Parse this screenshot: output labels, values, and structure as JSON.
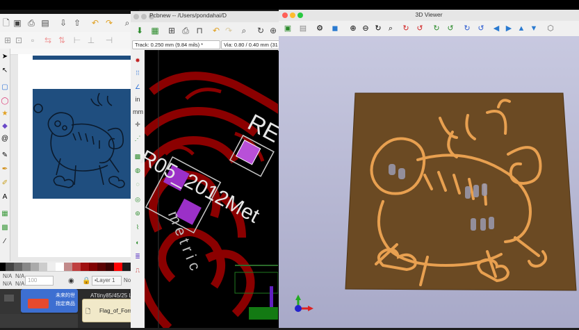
{
  "pcbnew": {
    "title": "Pcbnew -- /Users/pondahai/D",
    "track_select": "Track: 0.250 mm (9.84 mils) *",
    "via_select": "Via: 0.80 / 0.40 mm (31",
    "silk_ref": "RE",
    "silk_value": "R05_2012Met",
    "silk_small": "metric"
  },
  "viewer3d": {
    "title": "3D Viewer"
  },
  "inkscape": {
    "status_left_top": "N/A",
    "status_left_bottom": "N/A",
    "status_x": "N/A",
    "status_y": "N/A",
    "zoom_field": "100",
    "layer_select": "•Layer 1",
    "status_tail": "No"
  },
  "dock": {
    "window_label": "ATtiny85/45/25 LE",
    "card_text_top": "未來的世",
    "card_text_bottom": "指定商品",
    "folder_label": "Flag_of_Form"
  },
  "colors": {
    "pcb_board": "#8b0000",
    "pcb_pad": "#9b30c8",
    "board_3d": "#6b4a23",
    "silk_3d": "#e8a050",
    "inkscape_art": "#1f4e7f",
    "viewer_bg": "#bdbed9"
  },
  "icons": {
    "viewer_toolbar": [
      "reload-icon",
      "settings-icon",
      "cube-icon",
      "zoom-in-icon",
      "zoom-out-icon",
      "refresh-icon",
      "zoom-fit-icon",
      "rotate-x-cw-icon",
      "rotate-x-ccw-icon",
      "rotate-y-cw-icon",
      "rotate-y-ccw-icon",
      "rotate-z-cw-icon",
      "rotate-z-ccw-icon",
      "pan-left-icon",
      "pan-right-icon",
      "pan-up-icon",
      "pan-down-icon",
      "ortho-icon"
    ]
  }
}
